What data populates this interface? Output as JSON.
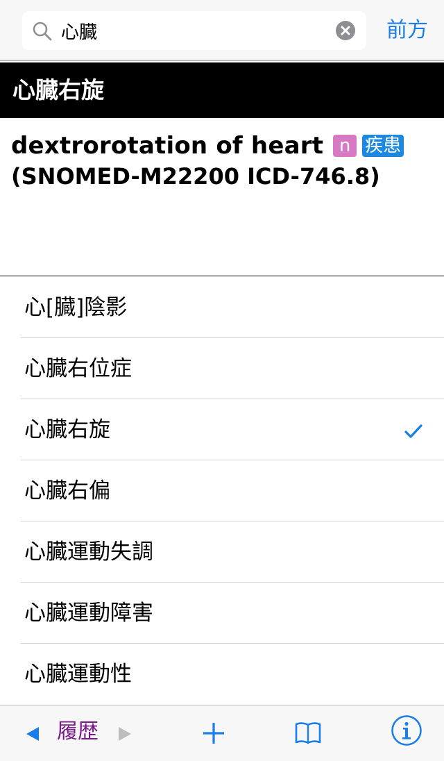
{
  "search": {
    "value": "心臓",
    "icon": "search-icon",
    "clear_icon": "clear-icon"
  },
  "header": {
    "forward_label": "前方"
  },
  "entry": {
    "title": "心臓右旋",
    "term": "dextrorotation of heart",
    "pos_badge": "n",
    "category_badge": "疾患",
    "codes": "(SNOMED-M22200 ICD-746.8)"
  },
  "results": {
    "items": [
      {
        "label": "心[臓]陰影",
        "selected": false
      },
      {
        "label": "心臓右位症",
        "selected": false
      },
      {
        "label": "心臓右旋",
        "selected": true
      },
      {
        "label": "心臓右偏",
        "selected": false
      },
      {
        "label": "心臓運動失調",
        "selected": false
      },
      {
        "label": "心臓運動障害",
        "selected": false
      },
      {
        "label": "心臓運動性",
        "selected": false
      }
    ]
  },
  "toolbar": {
    "history_label": "履歴",
    "back_icon": "back-arrow-icon",
    "forward_icon": "forward-arrow-icon",
    "add_icon": "add-icon",
    "bookmarks_icon": "bookmarks-icon",
    "info_icon": "info-icon"
  },
  "colors": {
    "accent": "#1a7de8",
    "history": "#7a1a8a",
    "pos_badge": "#d879c4",
    "category_badge": "#1d88e0",
    "title_bar": "#000000"
  }
}
